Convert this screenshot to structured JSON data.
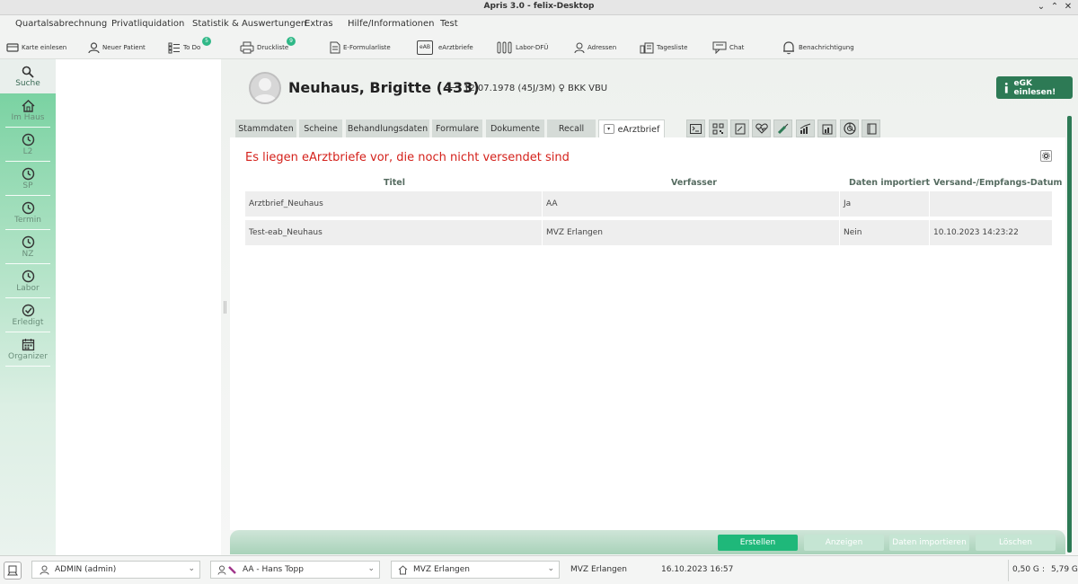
{
  "window": {
    "title": "Apris 3.0 - felix-Desktop"
  },
  "menu": [
    "Quartalsabrechnung",
    "Privatliquidation",
    "Statistik & Auswertungen",
    "Extras",
    "Hilfe/Informationen",
    "Test"
  ],
  "toolbar": [
    {
      "label": "Karte einlesen",
      "icon": "card-reader-icon"
    },
    {
      "label": "Neuer Patient",
      "icon": "person-icon"
    },
    {
      "label": "To Do",
      "icon": "todo-list-icon",
      "badge": "5"
    },
    {
      "label": "Druckliste",
      "icon": "printer-icon",
      "badge": "9"
    },
    {
      "label": "E-Formularliste",
      "icon": "form-icon"
    },
    {
      "label": "eArztbriefe",
      "icon": "eab-icon",
      "icon_text": "eAB"
    },
    {
      "label": "Labor-DFÜ",
      "icon": "lab-tubes-icon"
    },
    {
      "label": "Adressen",
      "icon": "address-book-icon"
    },
    {
      "label": "Tagesliste",
      "icon": "day-list-icon"
    },
    {
      "label": "Chat",
      "icon": "chat-icon"
    },
    {
      "label": "Benachrichtigung",
      "icon": "bell-icon"
    }
  ],
  "sidebar": [
    {
      "label": "Suche",
      "icon": "search-icon",
      "selected": true
    },
    {
      "label": "Im Haus",
      "icon": "house-icon"
    },
    {
      "label": "L2",
      "icon": "clock-icon"
    },
    {
      "label": "SP",
      "icon": "clock-icon"
    },
    {
      "label": "Termin",
      "icon": "clock-icon"
    },
    {
      "label": "NZ",
      "icon": "clock-icon"
    },
    {
      "label": "Labor",
      "icon": "clock-icon"
    },
    {
      "label": "Erledigt",
      "icon": "check-circle-icon"
    },
    {
      "label": "Organizer",
      "icon": "calendar-icon"
    }
  ],
  "patient": {
    "name": "Neuhaus, Brigitte (433)",
    "dash": "—",
    "info": "12.07.1978 (45J/3M) ♀ BKK VBU"
  },
  "egk_button": "eGK einlesen!",
  "tabs": [
    {
      "label": "Stammdaten"
    },
    {
      "label": "Scheine"
    },
    {
      "label": "Behandlungsdaten"
    },
    {
      "label": "Formulare"
    },
    {
      "label": "Dokumente"
    },
    {
      "label": "Recall"
    },
    {
      "label": "eArztbrief",
      "active": true
    }
  ],
  "tab_icons": [
    "terminal-icon",
    "qr-code-icon",
    "document-edit-icon",
    "heart-pulse-icon",
    "syringe-icon",
    "chart-growth-icon",
    "clipboard-chart-icon",
    "pie-chart-icon",
    "notebook-icon"
  ],
  "warning": "Es liegen eArztbriefe vor, die noch nicht versendet sind",
  "table": {
    "columns": [
      "Titel",
      "Verfasser",
      "Daten importiert",
      "Versand-/Empfangs-Datum"
    ],
    "rows": [
      [
        "Arztbrief_Neuhaus",
        "AA",
        "Ja",
        ""
      ],
      [
        "Test-eab_Neuhaus",
        "MVZ Erlangen",
        "Nein",
        "10.10.2023 14:23:22"
      ]
    ]
  },
  "actions": [
    {
      "label": "Erstellen",
      "enabled": true
    },
    {
      "label": "Anzeigen",
      "enabled": false
    },
    {
      "label": "Daten importieren",
      "enabled": false
    },
    {
      "label": "Löschen",
      "enabled": false
    }
  ],
  "status": {
    "user": "ADMIN  (admin)",
    "doctor": "AA - Hans Topp",
    "location": "MVZ Erlangen",
    "location_text": "MVZ Erlangen",
    "datetime": "16.10.2023 16:57",
    "mem_left": "0,50 G",
    "mem_sep": ":",
    "mem_right": "5,79 G"
  },
  "colors": {
    "accent": "#2d7a55",
    "primary_button": "#1fb87a",
    "warning": "#d4211b",
    "nav_green": "#6fcf9b"
  }
}
